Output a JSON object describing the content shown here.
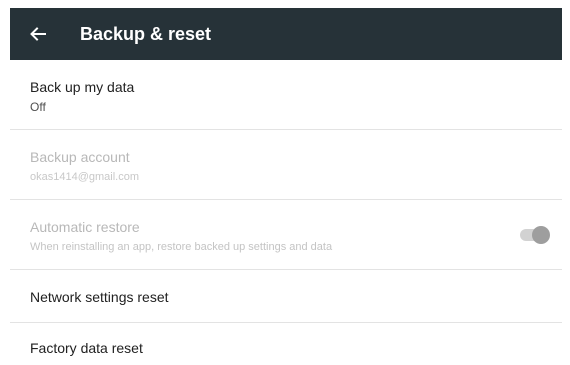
{
  "app_bar": {
    "title": "Backup & reset",
    "back_icon": "arrow-back-icon",
    "background": "#263238"
  },
  "settings": {
    "backup_my_data": {
      "title": "Back up my data",
      "summary": "Off"
    },
    "backup_account": {
      "title": "Backup account",
      "summary": "okas1414@gmail.com",
      "enabled": false
    },
    "automatic_restore": {
      "title": "Automatic restore",
      "summary": "When reinstalling an app, restore backed up settings and data",
      "enabled": false,
      "toggle_state": "on"
    },
    "network_reset": {
      "title": "Network settings reset"
    },
    "factory_reset": {
      "title": "Factory data reset"
    }
  }
}
